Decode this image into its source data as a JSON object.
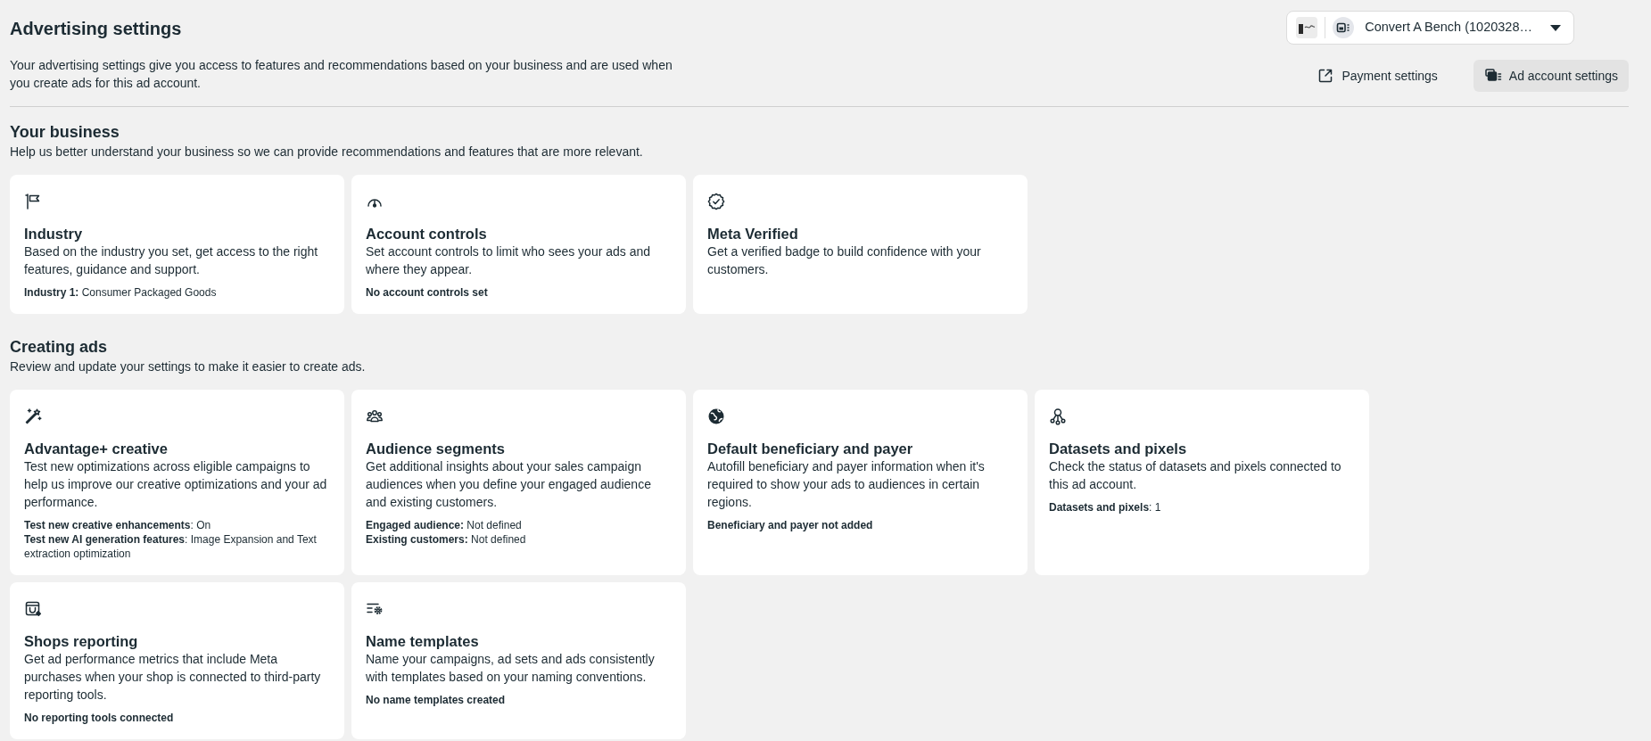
{
  "header": {
    "title": "Advertising settings",
    "description": "Your advertising settings give you access to features and recommendations based on your business and are used when you create ads for this ad account.",
    "account_selector": {
      "label": "Convert A Bench (1020328…"
    },
    "actions": [
      {
        "kind": "external_link",
        "label": "Payment settings"
      },
      {
        "kind": "secondary",
        "label": "Ad account settings"
      }
    ]
  },
  "sections": [
    {
      "title": "Your business",
      "subtitle": "Help us better understand your business so we can provide recommendations and features that are more relevant.",
      "cards": [
        {
          "title": "Industry",
          "description": "Based on the industry you set, get access to the right features, guidance and support.",
          "details": [
            {
              "kind": "setting",
              "text": "**Industry 1:** Consumer Packaged Goods"
            }
          ]
        },
        {
          "title": "Account controls",
          "description": "Set account controls to limit who sees your ads and where they appear.",
          "details": [
            {
              "kind": "status",
              "text": "No account controls set"
            }
          ]
        },
        {
          "title": "Meta Verified",
          "description": "Get a verified badge to build confidence with your customers."
        }
      ]
    },
    {
      "title": "Creating ads",
      "subtitle": "Review and update your settings to make it easier to create ads.",
      "cards": [
        {
          "title": "Advantage+ creative",
          "description": "Test new optimizations across eligible campaigns to help us improve our creative optimizations and your ad performance.",
          "details": [
            {
              "kind": "setting",
              "text": "**Test new creative enhancements**: On"
            },
            {
              "kind": "setting",
              "text": "**Test new AI generation features**: Image Expansion and Text extraction optimization"
            }
          ]
        },
        {
          "title": "Audience segments",
          "description": "Get additional insights about your sales campaign audiences when you define your engaged audience and existing customers.",
          "details": [
            {
              "kind": "setting",
              "text": "**Engaged audience:** Not defined"
            },
            {
              "kind": "setting",
              "text": "**Existing customers:** Not defined"
            }
          ]
        },
        {
          "title": "Default beneficiary and payer",
          "description": "Autofill beneficiary and payer information when it's required to show your ads to audiences in certain regions.",
          "details": [
            {
              "kind": "status",
              "text": "Beneficiary and payer not added"
            }
          ]
        },
        {
          "title": "Datasets and pixels",
          "description": "Check the status of datasets and pixels connected to this ad account.",
          "details": [
            {
              "kind": "setting",
              "text": "**Datasets and pixels**: 1"
            }
          ]
        },
        {
          "title": "Shops reporting",
          "description": "Get ad performance metrics that include Meta purchases when your shop is connected to third-party reporting tools.",
          "details": [
            {
              "kind": "status",
              "text": "No reporting tools connected"
            }
          ]
        },
        {
          "title": "Name templates",
          "description": "Name your campaigns, ad sets and ads consistently with templates based on your naming conventions.",
          "details": [
            {
              "kind": "status",
              "text": "No name templates created"
            }
          ]
        }
      ]
    }
  ]
}
